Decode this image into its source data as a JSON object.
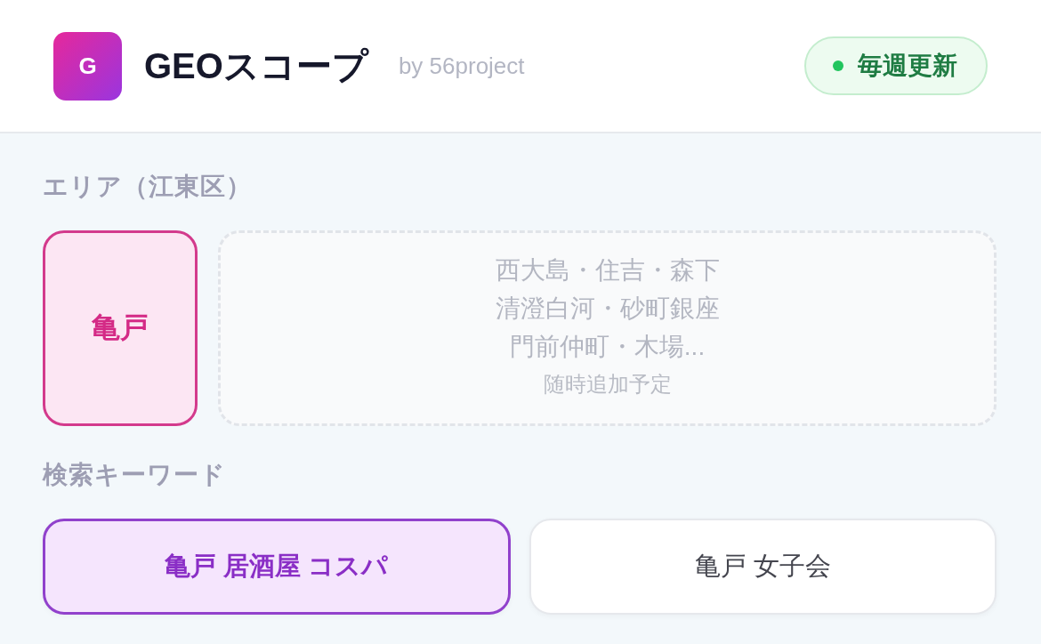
{
  "header": {
    "logo_letter": "G",
    "title": "GEOスコープ",
    "byline": "by 56project",
    "badge": {
      "label": "毎週更新"
    }
  },
  "area": {
    "label": "エリア（江東区）",
    "items": [
      {
        "label": "亀戸",
        "selected": true
      }
    ],
    "upcoming": {
      "lines": [
        "西大島・住吉・森下",
        "清澄白河・砂町銀座",
        "門前仲町・木場..."
      ],
      "note": "随時追加予定"
    }
  },
  "keywords": {
    "label": "検索キーワード",
    "items": [
      {
        "label": "亀戸 居酒屋 コスパ",
        "selected": true
      },
      {
        "label": "亀戸 女子会",
        "selected": false
      }
    ]
  }
}
